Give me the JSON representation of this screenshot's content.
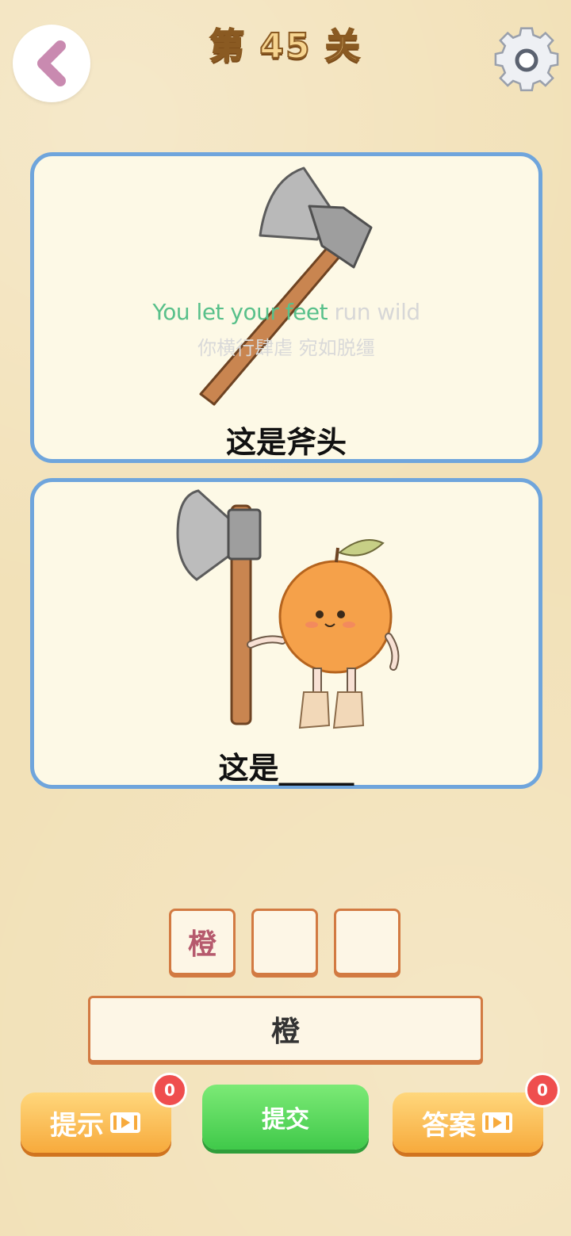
{
  "header": {
    "title": "第 45 关",
    "back_icon": "chevron-left-icon",
    "settings_icon": "gear-icon"
  },
  "card1": {
    "subtitle_en_highlight": "You let your feet",
    "subtitle_en_rest": " run wild",
    "subtitle_zh": "你横行肆虐 宛如脱缰",
    "caption": "这是斧头",
    "illustration": "axe"
  },
  "card2": {
    "caption": "这是_____",
    "illustration": "axe-and-orange-holding-hands"
  },
  "answer_slots": [
    "橙",
    "",
    ""
  ],
  "choice": "橙",
  "buttons": {
    "hint_label": "提示",
    "hint_count": "0",
    "submit_label": "提交",
    "answer_label": "答案",
    "answer_count": "0"
  },
  "colors": {
    "background": "#f2e1b8",
    "card_border": "#6fa5dc",
    "slot_border": "#d27a42",
    "submit_green": "#40c94a",
    "hint_orange": "#f7aa3c",
    "badge_red": "#ef4e4e"
  }
}
